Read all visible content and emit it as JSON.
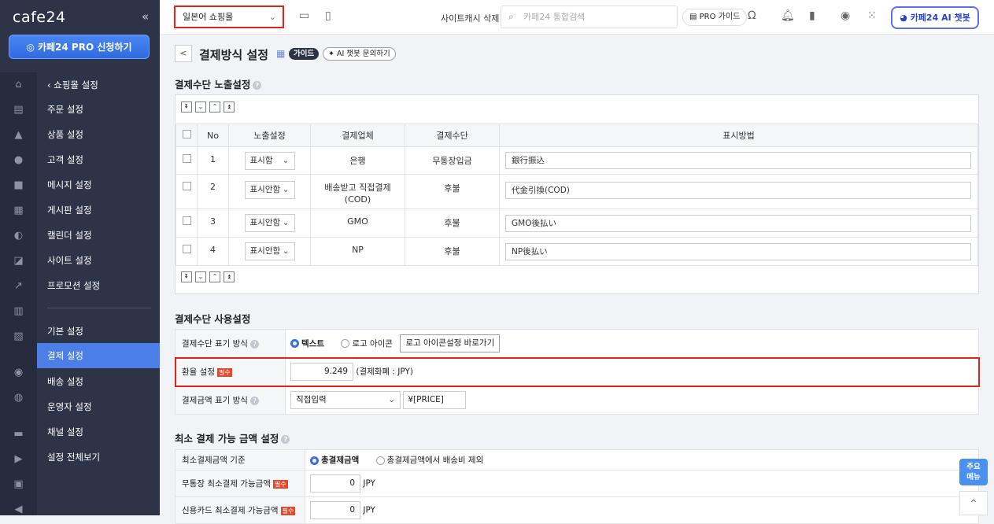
{
  "sidebar": {
    "logo": "cafe24",
    "collapse": "«",
    "pro_button": "카페24 PRO 신청하기",
    "back_item": "쇼핑몰 설정",
    "items": [
      {
        "label": "주문 설정"
      },
      {
        "label": "상품 설정"
      },
      {
        "label": "고객 설정"
      },
      {
        "label": "메시지 설정"
      },
      {
        "label": "게시판 설정"
      },
      {
        "label": "캘린더 설정"
      },
      {
        "label": "사이트 설정"
      },
      {
        "label": "프로모션 설정"
      },
      {
        "label": "기본 설정"
      },
      {
        "label": "결제 설정"
      },
      {
        "label": "배송 설정"
      },
      {
        "label": "운영자 설정"
      },
      {
        "label": "채널 설정"
      },
      {
        "label": "설정 전체보기"
      }
    ],
    "active": "결제 설정"
  },
  "topbar": {
    "shop_select": "일본어 쇼핑몰",
    "cache_delete": "사이트캐시 삭제",
    "search_placeholder": "카페24 통합검색",
    "pro_guide": "PRO 가이드",
    "ai_chatbot": "카페24 AI 챗봇"
  },
  "page": {
    "title": "결제방식 설정",
    "guide_badge": "가이드",
    "ai_question": "AI 챗봇 문의하기",
    "back": "<"
  },
  "payment_display": {
    "section_title": "결제수단 노출설정",
    "headers": [
      "No",
      "노출설정",
      "결제업체",
      "결제수단",
      "표시방법"
    ],
    "rows": [
      {
        "no": "1",
        "display": "표시함",
        "provider": "은행",
        "method": "무통장입금",
        "label": "銀行振込"
      },
      {
        "no": "2",
        "display": "표시안함",
        "provider": "배송받고 직접결제\n(COD)",
        "method": "후불",
        "label": "代金引換(COD)"
      },
      {
        "no": "3",
        "display": "표시안함",
        "provider": "GMO",
        "method": "후불",
        "label": "GMO後払い"
      },
      {
        "no": "4",
        "display": "표시안함",
        "provider": "NP",
        "method": "후불",
        "label": "NP後払い"
      }
    ]
  },
  "usage": {
    "section_title": "결제수단 사용설정",
    "display_type": {
      "label": "결제수단 표기 방식",
      "option_text": "텍스트",
      "option_logo": "로고 아이콘",
      "logo_button": "로고 아이콘설정 바로가기"
    },
    "exchange": {
      "label": "환율 설정",
      "required": "필수",
      "value": "9.249",
      "note": "(결제화폐 : JPY)"
    },
    "amount_format": {
      "label": "결제금액 표기 방식",
      "select": "직접입력",
      "value": "¥[PRICE]"
    }
  },
  "minimum": {
    "section_title": "최소 결제 가능 금액 설정",
    "basis": {
      "label": "최소결제금액 기준",
      "option_total": "총결제금액",
      "option_excl": "총결제금액에서 배송비 제외"
    },
    "bank_min": {
      "label": "무통장 최소결제 가능금액",
      "required": "필수",
      "value": "0",
      "unit": "JPY"
    },
    "card_min": {
      "label": "신용카드 최소결제 가능금액",
      "required": "필수",
      "value": "0",
      "unit": "JPY"
    }
  },
  "floating": {
    "quick_menu_1": "주요",
    "quick_menu_2": "메뉴",
    "scroll_top": "^"
  },
  "colors": {
    "sidebar": "#2d3447",
    "active": "#4b7ee6",
    "highlight": "#e2241c",
    "primary": "#3b6fe0"
  }
}
